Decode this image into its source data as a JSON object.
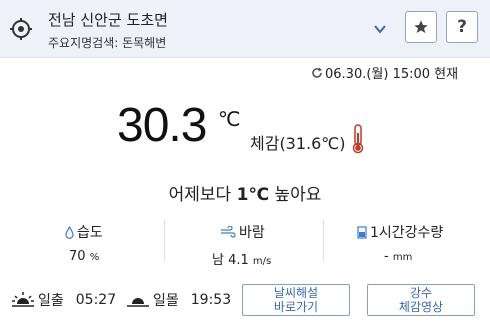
{
  "header": {
    "location": "전남 신안군 도초면",
    "search_label": "주요지명검색: 돈목해변",
    "icons": {
      "location": "crosshair-icon",
      "dropdown": "chevron-down-icon",
      "favorite": "star-icon"
    },
    "help_label": "?"
  },
  "current": {
    "datetime": "06.30.(월) 15:00 현재",
    "temperature": "30.3",
    "temp_unit": "℃",
    "feels_like": "체감(31.6℃)",
    "compare_prefix": "어제보다 ",
    "compare_value": "1℃",
    "compare_suffix": " 높아요"
  },
  "stats": {
    "humidity": {
      "label": "습도",
      "value": "70",
      "unit": "%"
    },
    "wind": {
      "label": "바람",
      "value": "남 4.1",
      "unit": "m/s"
    },
    "rain": {
      "label": "1시간강수량",
      "value": "-",
      "unit": "mm"
    }
  },
  "sun": {
    "sunrise_label": "일출",
    "sunrise_time": "05:27",
    "sunset_label": "일몰",
    "sunset_time": "19:53"
  },
  "links": {
    "weather_commentary_line1": "날씨해설",
    "weather_commentary_line2": "바로가기",
    "sensible_video_line1": "강수",
    "sensible_video_line2": "체감영상"
  },
  "colors": {
    "accent": "#3868b8",
    "header_bg": "#eef1f7",
    "thermo": "#c0392b"
  }
}
